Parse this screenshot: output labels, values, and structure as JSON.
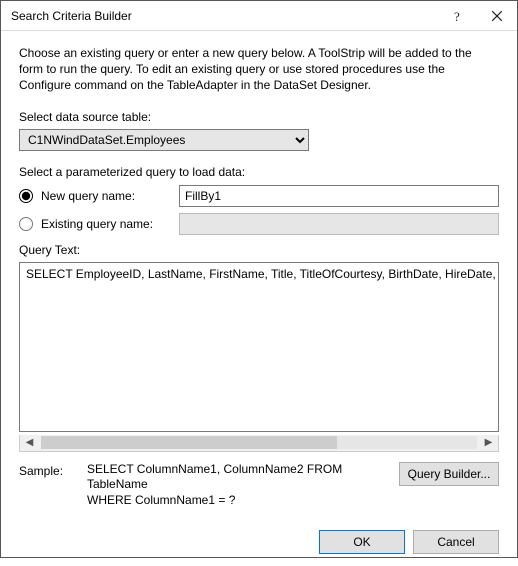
{
  "titlebar": {
    "title": "Search Criteria Builder"
  },
  "description": "Choose an existing query or enter a new query below. A ToolStrip will be added to the form to run the query. To edit an existing query or use stored procedures use the Configure command on the TableAdapter in the DataSet Designer.",
  "data_source": {
    "label": "Select data source table:",
    "value": "C1NWindDataSet.Employees"
  },
  "param_label": "Select a parameterized query to load data:",
  "new_query": {
    "label": "New query name:",
    "value": "FillBy1"
  },
  "existing_query": {
    "label": "Existing query name:"
  },
  "query_text": {
    "label": "Query Text:",
    "value": "SELECT EmployeeID, LastName, FirstName, Title, TitleOfCourtesy, BirthDate, HireDate, A"
  },
  "sample": {
    "label": "Sample:",
    "text": "SELECT ColumnName1, ColumnName2 FROM TableName\nWHERE ColumnName1 = ?"
  },
  "buttons": {
    "query_builder": "Query Builder...",
    "ok": "OK",
    "cancel": "Cancel"
  }
}
